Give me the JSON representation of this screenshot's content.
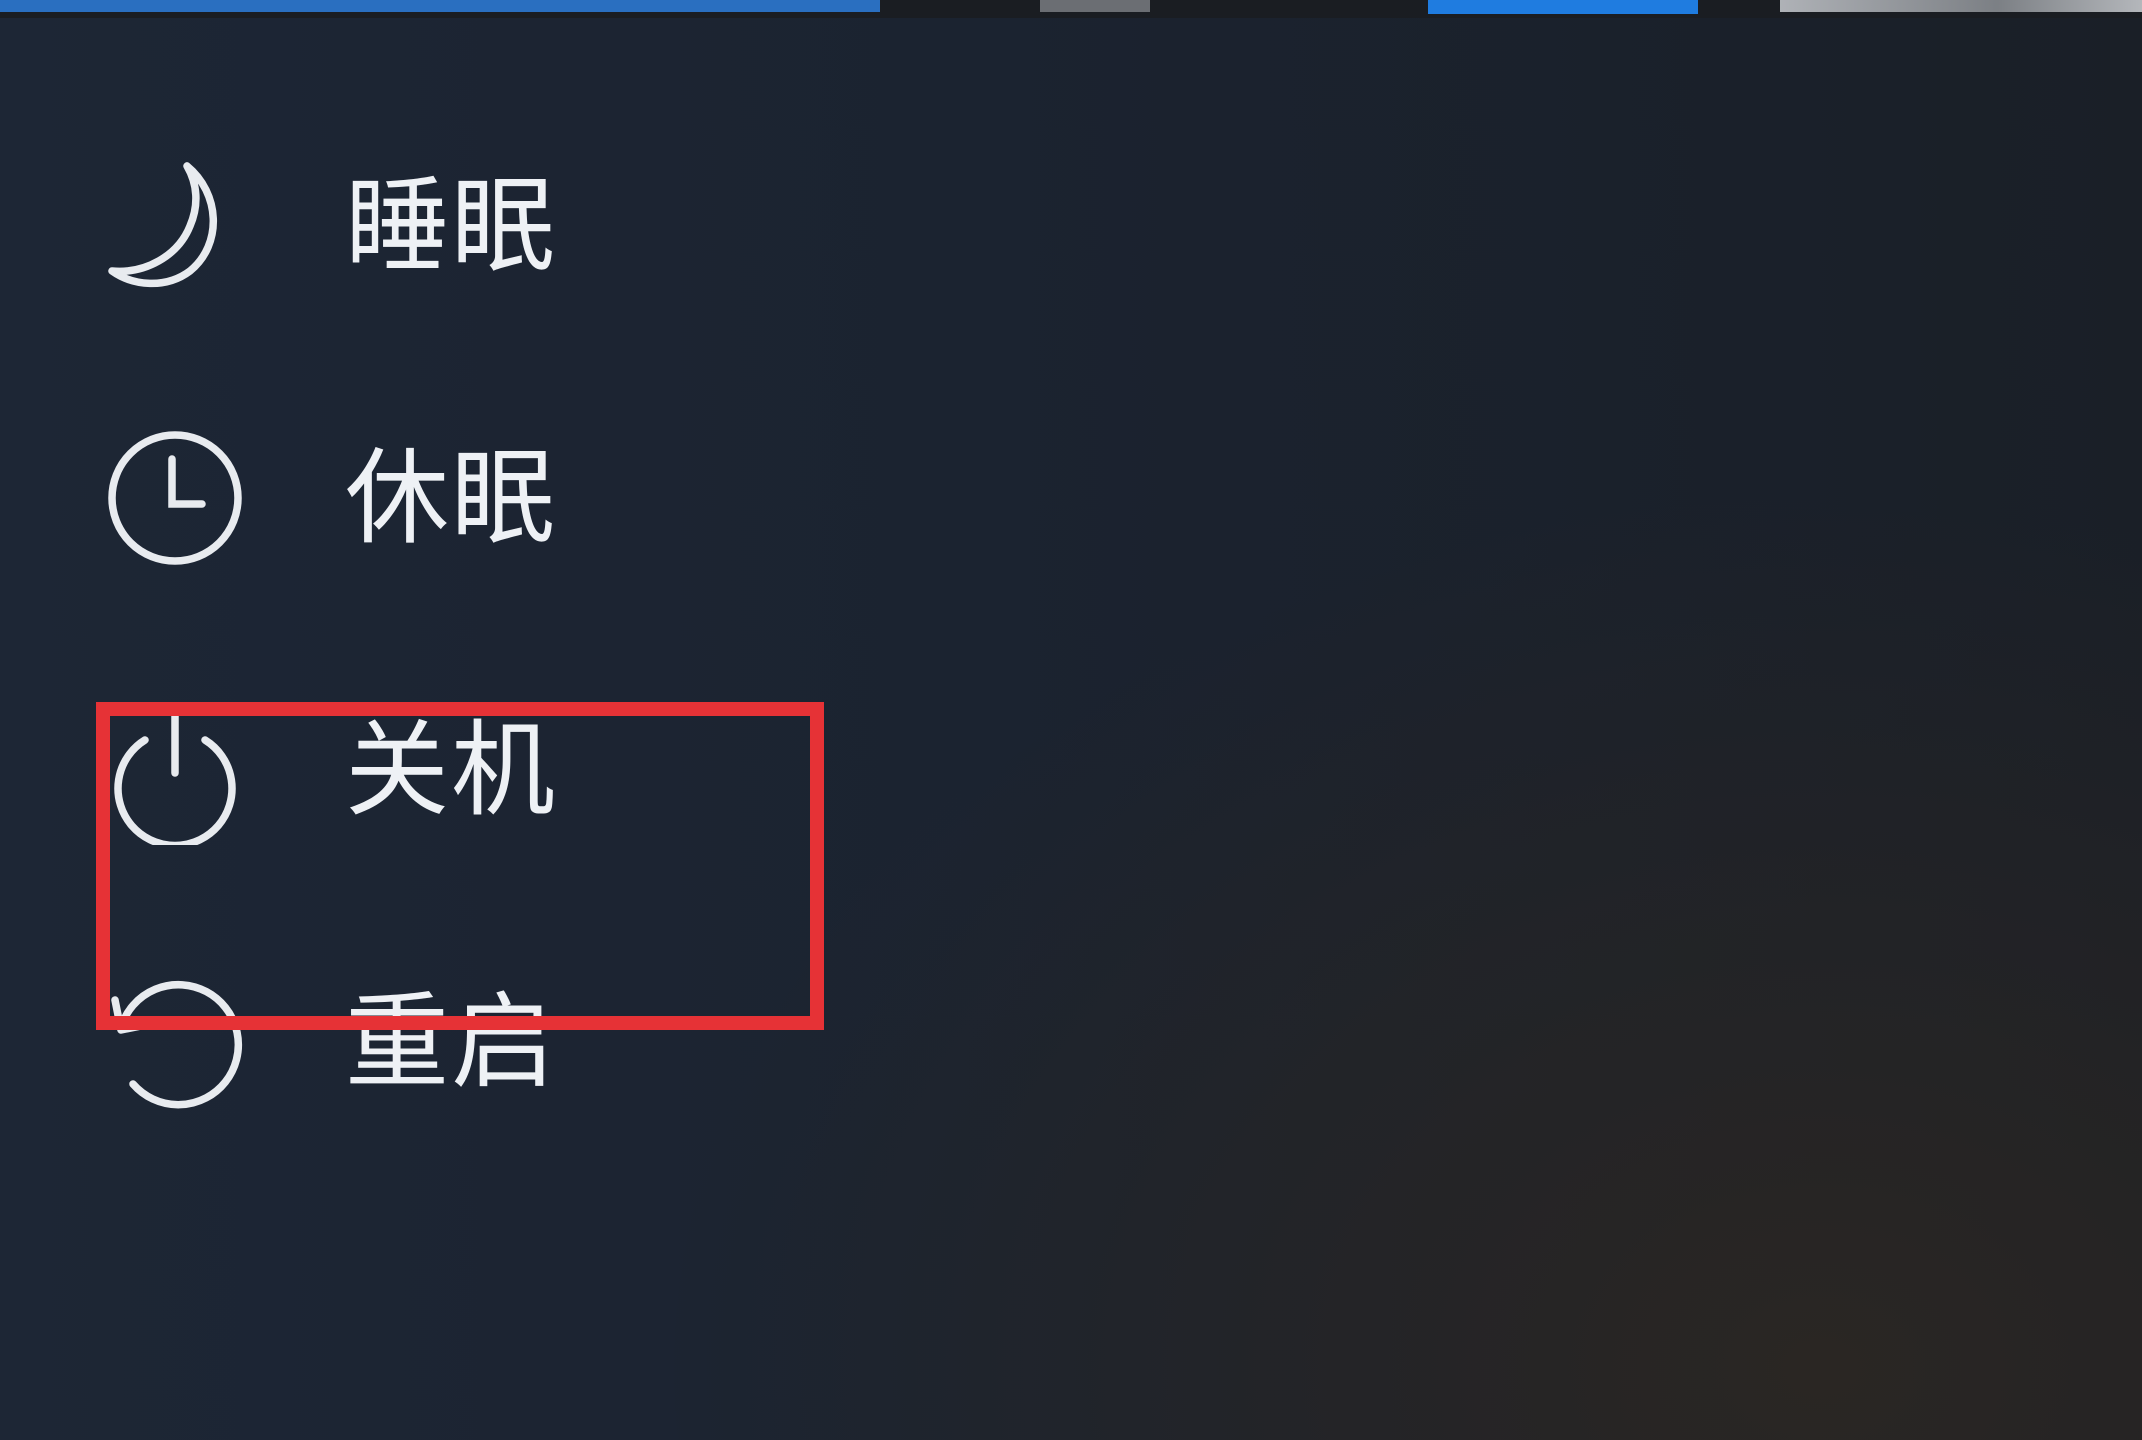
{
  "power_menu": {
    "items": [
      {
        "label": "睡眠",
        "icon": "moon-icon"
      },
      {
        "label": "休眠",
        "icon": "clock-icon"
      },
      {
        "label": "关机",
        "icon": "power-icon",
        "highlighted": true
      },
      {
        "label": "重启",
        "icon": "restart-icon"
      }
    ]
  },
  "colors": {
    "background": "#1b2431",
    "text": "#eef1f5",
    "highlight_border": "#e63236"
  }
}
